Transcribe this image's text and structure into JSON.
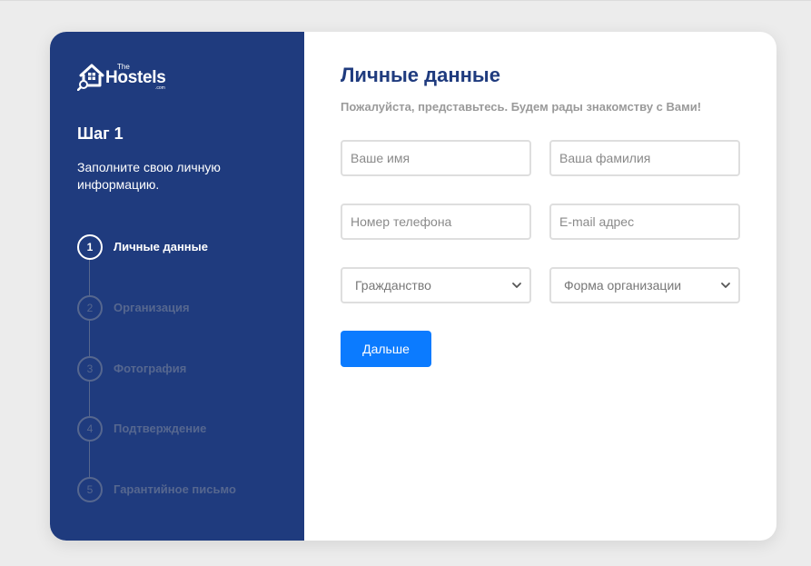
{
  "logo": {
    "the": "The",
    "name": "Hostels",
    "com": ".com"
  },
  "sidebar": {
    "step_title": "Шаг 1",
    "step_desc": "Заполните свою личную информацию.",
    "steps": [
      {
        "number": "1",
        "label": "Личные данные",
        "active": true
      },
      {
        "number": "2",
        "label": "Организация",
        "active": false
      },
      {
        "number": "3",
        "label": "Фотография",
        "active": false
      },
      {
        "number": "4",
        "label": "Подтверждение",
        "active": false
      },
      {
        "number": "5",
        "label": "Гарантийное письмо",
        "active": false
      }
    ]
  },
  "form": {
    "title": "Личные данные",
    "subtitle": "Пожалуйста, представьтесь. Будем рады знакомству с Вами!",
    "first_name": {
      "placeholder": "Ваше имя",
      "value": ""
    },
    "last_name": {
      "placeholder": "Ваша фамилия",
      "value": ""
    },
    "phone": {
      "placeholder": "Номер телефона",
      "value": ""
    },
    "email": {
      "placeholder": "E-mail адрес",
      "value": ""
    },
    "citizenship": {
      "selected": "Гражданство"
    },
    "org_form": {
      "selected": "Форма организации"
    },
    "next_label": "Дальше"
  },
  "colors": {
    "sidebar": "#1f3b7e",
    "title": "#1f3b7e",
    "button": "#0b7bff",
    "inactive_step": "#56678f"
  },
  "icons": {
    "logo": "house-magnifier-icon",
    "select_arrow": "chevron-down-icon"
  }
}
